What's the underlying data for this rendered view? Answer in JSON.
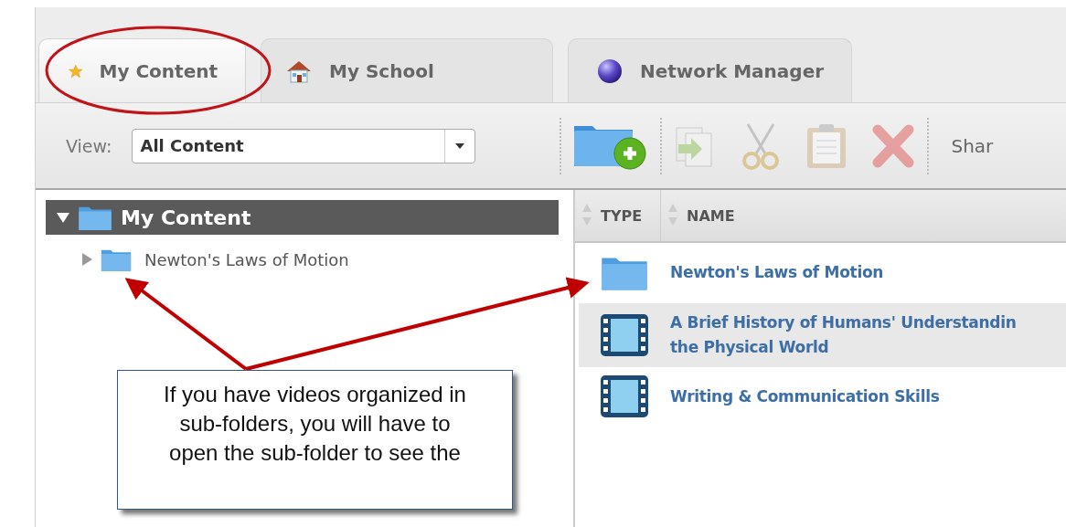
{
  "tabs": [
    {
      "label": "My Content",
      "kind": "star",
      "selected": true
    },
    {
      "label": "My School",
      "kind": "house",
      "selected": false
    },
    {
      "label": "Network Manager",
      "kind": "globe",
      "selected": false
    }
  ],
  "toolbar": {
    "view_label": "View:",
    "view_value": "All Content",
    "actions": [
      {
        "kind": "new-folder",
        "disabled": false
      },
      {
        "kind": "copy",
        "disabled": true
      },
      {
        "kind": "cut",
        "disabled": true
      },
      {
        "kind": "paste",
        "disabled": true
      },
      {
        "kind": "delete",
        "disabled": true
      }
    ],
    "share_label": "Shar"
  },
  "tree": {
    "label": "My Content",
    "expanded": true,
    "children": [
      {
        "label": "Newton's Laws of Motion",
        "expanded": false
      }
    ]
  },
  "list": {
    "columns": [
      "TYPE",
      "NAME"
    ],
    "rows": [
      {
        "kind": "folder",
        "name": [
          "Newton's Laws of Motion"
        ],
        "selected": false
      },
      {
        "kind": "video",
        "name": [
          "A Brief History of Humans' Understandin",
          "the Physical World"
        ],
        "selected": true
      },
      {
        "kind": "video",
        "name": [
          "Writing & Communication Skills"
        ],
        "selected": false
      }
    ]
  },
  "callout": {
    "text": "If you have videos organized in sub-folders, you will have to open the sub-folder to see the"
  }
}
